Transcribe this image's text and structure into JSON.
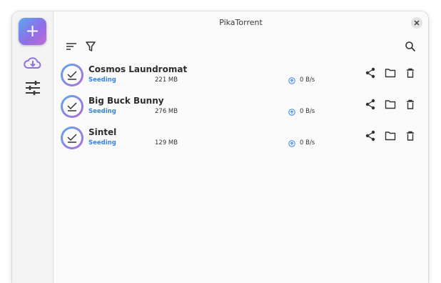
{
  "app": {
    "title": "PikaTorrent"
  },
  "sidebar": {
    "add_label": "+",
    "items": [
      {
        "icon": "cloud-download-icon"
      },
      {
        "icon": "sliders-icon"
      }
    ]
  },
  "toolbar": {
    "sort_icon": "sort-icon",
    "filter_icon": "filter-icon",
    "search_icon": "search-icon"
  },
  "torrents": [
    {
      "name": "Cosmos Laundromat",
      "status": "Seeding",
      "size": "221 MB",
      "upload_speed": "0 B/s"
    },
    {
      "name": "Big Buck Bunny",
      "status": "Seeding",
      "size": "276 MB",
      "upload_speed": "0 B/s"
    },
    {
      "name": "Sintel",
      "status": "Seeding",
      "size": "129 MB",
      "upload_speed": "0 B/s"
    }
  ],
  "colors": {
    "accent": "#3584e4",
    "gradient_start": "#5aa8ef",
    "gradient_end": "#c06ad6"
  }
}
